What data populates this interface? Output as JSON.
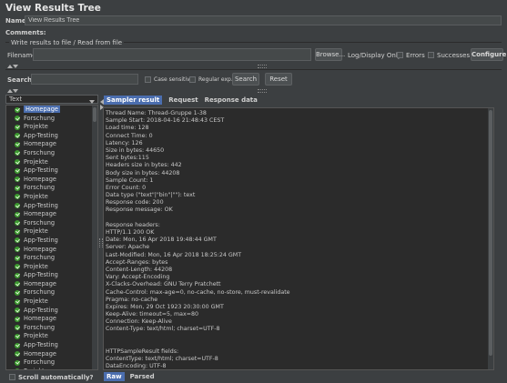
{
  "header": {
    "title": "View Results Tree",
    "name_label": "Name:",
    "name_value": "View Results Tree",
    "comments_label": "Comments:"
  },
  "file_section": {
    "legend": "Write results to file / Read from file",
    "filename_label": "Filename",
    "filename_value": "",
    "browse_label": "Browse...",
    "log_display_label": "Log/Display Only:",
    "errors_label": "Errors",
    "successes_label": "Successes",
    "configure_label": "Configure"
  },
  "search": {
    "label": "Search:",
    "value": "",
    "case_sensitive_label": "Case sensitive",
    "regex_label": "Regular exp.",
    "search_button": "Search",
    "reset_button": "Reset"
  },
  "renderer": {
    "selected": "Text"
  },
  "tree": {
    "items": [
      "Homepage",
      "Forschung",
      "Projekte",
      "App-Testing",
      "Homepage",
      "Forschung",
      "Projekte",
      "App-Testing",
      "Homepage",
      "Forschung",
      "Projekte",
      "App-Testing",
      "Homepage",
      "Forschung",
      "Projekte",
      "App-Testing",
      "Homepage",
      "Forschung",
      "Projekte",
      "App-Testing",
      "Homepage",
      "Forschung",
      "Projekte",
      "App-Testing",
      "Homepage",
      "Forschung",
      "Projekte",
      "App-Testing",
      "Homepage",
      "Forschung",
      "Projekte"
    ],
    "selected_index": 0,
    "scroll_automatically_label": "Scroll automatically?"
  },
  "tabs": {
    "sampler_result": "Sampler result",
    "request": "Request",
    "response_data": "Response data"
  },
  "sampler_result_lines": [
    "Thread Name: Thread-Gruppe 1-38",
    "Sample Start: 2018-04-16 21:48:43 CEST",
    "Load time: 128",
    "Connect Time: 0",
    "Latency: 126",
    "Size in bytes: 44650",
    "Sent bytes:115",
    "Headers size in bytes: 442",
    "Body size in bytes: 44208",
    "Sample Count: 1",
    "Error Count: 0",
    "Data type (\"text\"|\"bin\"|\"\"): text",
    "Response code: 200",
    "Response message: OK",
    "",
    "Response headers:",
    "HTTP/1.1 200 OK",
    "Date: Mon, 16 Apr 2018 19:48:44 GMT",
    "Server: Apache",
    "Last-Modified: Mon, 16 Apr 2018 18:25:24 GMT",
    "Accept-Ranges: bytes",
    "Content-Length: 44208",
    "Vary: Accept-Encoding",
    "X-Clacks-Overhead: GNU Terry Pratchett",
    "Cache-Control: max-age=0, no-cache, no-store, must-revalidate",
    "Pragma: no-cache",
    "Expires: Mon, 29 Oct 1923 20:30:00 GMT",
    "Keep-Alive: timeout=5, max=80",
    "Connection: Keep-Alive",
    "Content-Type: text/html; charset=UTF-8",
    "",
    "",
    "HTTPSampleResult fields:",
    "ContentType: text/html; charset=UTF-8",
    "DataEncoding: UTF-8"
  ],
  "bottom_tabs": {
    "raw": "Raw",
    "parsed": "Parsed"
  },
  "colors": {
    "background": "#3c3f41",
    "panel": "#2b2b2b",
    "selection": "#4b6eaf",
    "success_icon": "#3c9a2f"
  }
}
